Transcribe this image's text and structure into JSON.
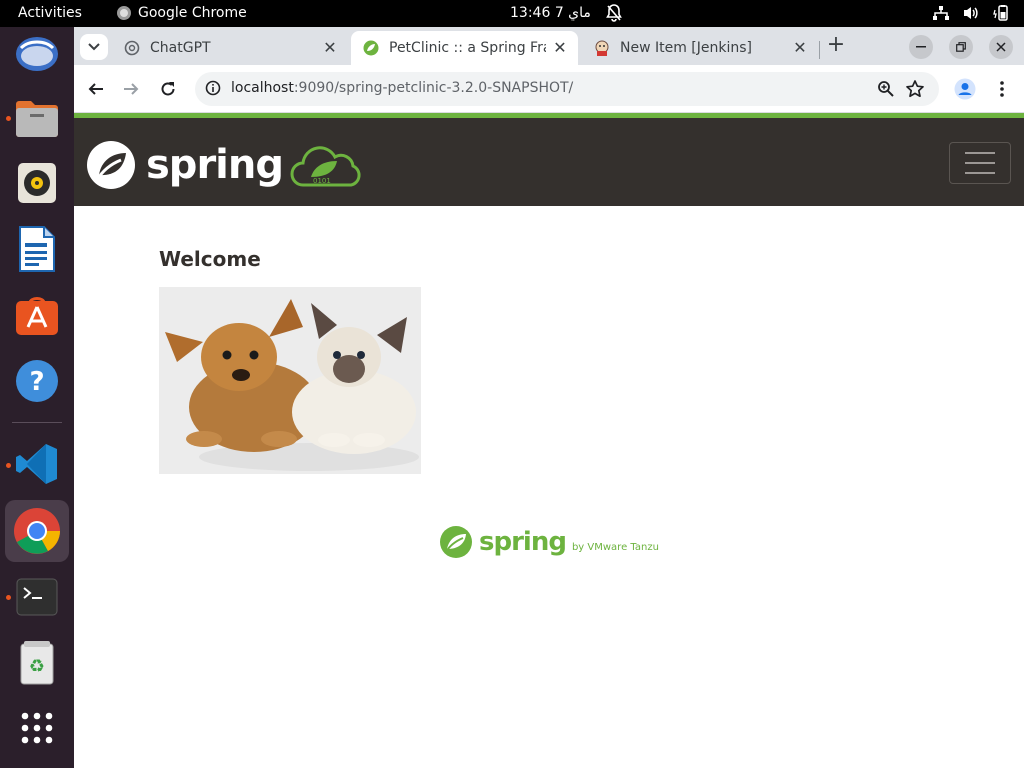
{
  "topbar": {
    "activities": "Activities",
    "app_name": "Google Chrome",
    "clock": "ماي 7  13:46"
  },
  "dock": {
    "items": [
      {
        "name": "thunderbird-icon",
        "running": false
      },
      {
        "name": "files-icon",
        "running": true
      },
      {
        "name": "rhythmbox-icon",
        "running": false
      },
      {
        "name": "libreoffice-writer-icon",
        "running": false
      },
      {
        "name": "app-center-icon",
        "running": false
      },
      {
        "name": "help-icon",
        "running": false
      },
      {
        "name": "vscode-icon",
        "running": true
      },
      {
        "name": "chrome-icon",
        "running": true
      },
      {
        "name": "terminal-icon",
        "running": true
      },
      {
        "name": "trash-icon",
        "running": false
      },
      {
        "name": "app-grid-icon",
        "running": false
      }
    ]
  },
  "browser": {
    "tabs": [
      {
        "title": "ChatGPT",
        "active": false,
        "icon": "openai-icon"
      },
      {
        "title": "PetClinic :: a Spring Framework demonstration",
        "active": true,
        "icon": "spring-icon"
      },
      {
        "title": "New Item [Jenkins]",
        "active": false,
        "icon": "jenkins-icon"
      }
    ],
    "new_tab": "+",
    "close_glyph": "✕",
    "url_host": "localhost",
    "url_path": ":9090/spring-petclinic-3.2.0-SNAPSHOT/"
  },
  "page": {
    "brand": "spring",
    "heading": "Welcome",
    "image_alt": "pets-image",
    "footer_brand": "spring",
    "footer_by": "by VMware Tanzu"
  },
  "colors": {
    "spring_green": "#6db33f",
    "navbar_bg": "#34302d",
    "dock_bg": "#2b1f2b",
    "running_dot": "#e95420"
  }
}
